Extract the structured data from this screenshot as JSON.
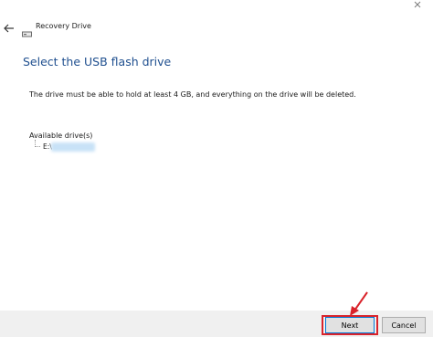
{
  "window": {
    "title": "Recovery Drive",
    "icons": {
      "back": "back-arrow-icon",
      "title": "drive-icon",
      "close": "close-icon"
    }
  },
  "main": {
    "heading": "Select the USB flash drive",
    "description": "The drive must be able to hold at least 4 GB, and everything on the drive will be deleted.",
    "drives_label": "Available drive(s)",
    "drives": [
      {
        "letter": "E:\\",
        "name_redacted": true
      }
    ]
  },
  "footer": {
    "next_label": "Next",
    "cancel_label": "Cancel"
  },
  "annotation": {
    "highlight_color": "#d9232b",
    "target": "next-button"
  },
  "colors": {
    "heading": "#1f4f8f",
    "footer_bg": "#f0f0f0",
    "button_bg": "#e1e1e1",
    "focus_border": "#0078d7"
  }
}
